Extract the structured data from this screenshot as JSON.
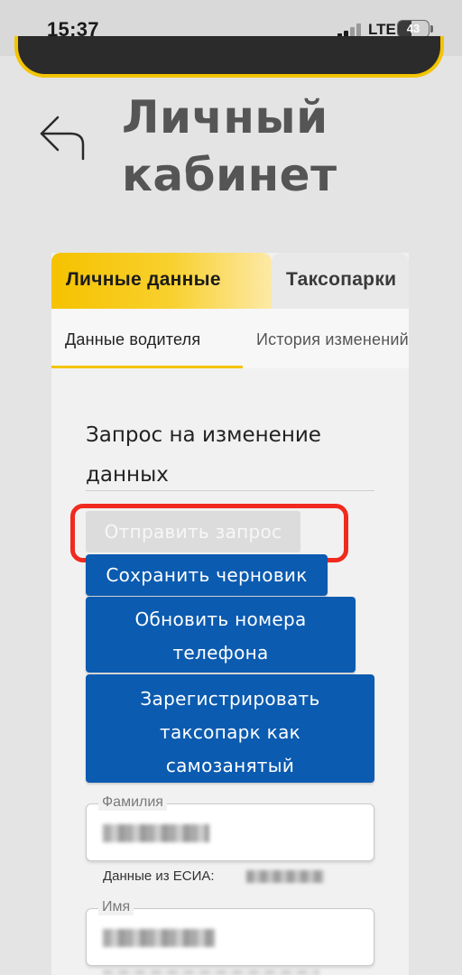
{
  "status_bar": {
    "time": "15:37",
    "network": "LTE",
    "battery": "43",
    "battery_level_percent": 43,
    "signal_icon": "signal-bars-icon"
  },
  "page": {
    "title_line1": "Личный",
    "title_line2": "кабинет",
    "back_icon": "back-arrow-icon"
  },
  "tabs": [
    {
      "label": "Личные данные",
      "active": true
    },
    {
      "label": "Таксопарки",
      "active": false
    }
  ],
  "subtabs": [
    {
      "label": "Данные водителя",
      "active": true
    },
    {
      "label": "История изменений",
      "active": false
    }
  ],
  "section": {
    "title": "Запрос на изменение данных"
  },
  "buttons": {
    "send_request": "Отправить запрос",
    "save_draft": "Сохранить черновик",
    "update_phone": "Обновить номера телефона",
    "register_park": "Зарегистрировать таксопарк как самозанятый"
  },
  "fields": {
    "surname_label": "Фамилия",
    "esia_note": "Данные из ЕСИА:",
    "name_label": "Имя"
  },
  "colors": {
    "accent_yellow": "#f4c400",
    "primary_blue": "#0b5bb0",
    "highlight_red": "#f02a1f",
    "background": "#e4e4e4"
  }
}
